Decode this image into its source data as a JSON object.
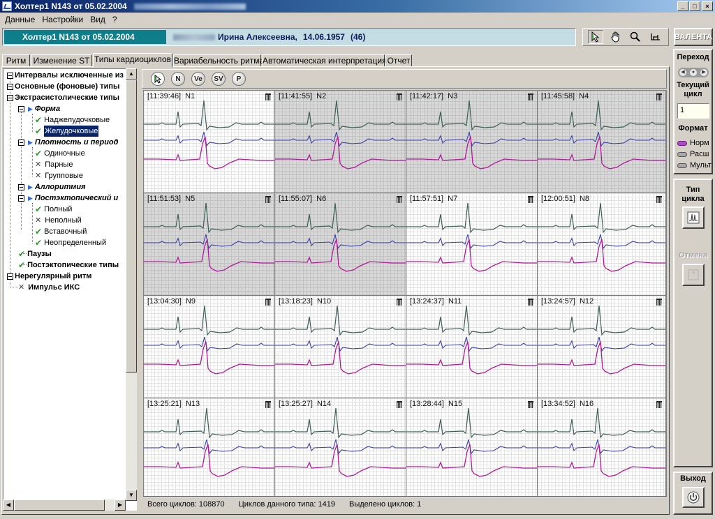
{
  "window": {
    "title": "Холтер1  N143 от 05.02.2004",
    "controls": [
      "_",
      "□",
      "×"
    ]
  },
  "menu": [
    "Данные",
    "Настройки",
    "Вид",
    "?"
  ],
  "record_bar": {
    "record": "Холтер1  N143 от 05.02.2004",
    "patient_name": "Ирина Алексеевна,",
    "birth_date": "14.06.1957",
    "age": "(46)"
  },
  "tools": {
    "pointer": "pointer-icon",
    "hand": "hand-icon",
    "zoom": "magnifier-icon",
    "measure": "caliper-icon"
  },
  "brand": "ВАЛЕНТА",
  "tabs": [
    "Ритм",
    "Изменение ST",
    "Типы кардиоциклов",
    "Вариабельность ритма",
    "Автоматическая интерпретация",
    "Отчет"
  ],
  "active_tab": "Типы кардиоциклов",
  "tree": [
    "Интервалы исключенные из",
    "Основные (фоновые) типы",
    "Экстрасистолические типы",
    "Форма",
    "Наджелудочковые",
    "Желудочковые",
    "Плотность и период",
    "Одиночные",
    "Парные",
    "Групповые",
    "Аллоритмия",
    "Постэктопический и",
    "Полный",
    "Неполный",
    "Вставочный",
    "Неопределенный",
    "Паузы",
    "Постэктопические типы",
    "Нерегулярный ритм",
    "Импульс ИКС"
  ],
  "cycle_toolbar": [
    "N",
    "Ve",
    "SV",
    "P"
  ],
  "cycles": [
    {
      "time": "[11:39:46]",
      "id": "N1"
    },
    {
      "time": "[11:41:55]",
      "id": "N2"
    },
    {
      "time": "[11:42:17]",
      "id": "N3"
    },
    {
      "time": "[11:45:58]",
      "id": "N4"
    },
    {
      "time": "[11:51:53]",
      "id": "N5"
    },
    {
      "time": "[11:55:07]",
      "id": "N6"
    },
    {
      "time": "[11:57:51]",
      "id": "N7"
    },
    {
      "time": "[12:00:51]",
      "id": "N8"
    },
    {
      "time": "[13:04:30]",
      "id": "N9"
    },
    {
      "time": "[13:18:23]",
      "id": "N10"
    },
    {
      "time": "[13:24:37]",
      "id": "N11"
    },
    {
      "time": "[13:24:57]",
      "id": "N12"
    },
    {
      "time": "[13:25:21]",
      "id": "N13"
    },
    {
      "time": "[13:25:27]",
      "id": "N14"
    },
    {
      "time": "[13:28:44]",
      "id": "N15"
    },
    {
      "time": "[13:34:52]",
      "id": "N16"
    }
  ],
  "status": {
    "total": "Всего циклов: 108870",
    "this_type": "Циклов данного типа: 1419",
    "selected": "Выделено циклов: 1"
  },
  "right_panel": {
    "navigate": "Переход",
    "current_cycle_label1": "Текущий",
    "current_cycle_label2": "цикл",
    "current_cycle_value": "1",
    "format_label": "Формат",
    "formats": [
      "Норм",
      "Расш",
      "Мульт"
    ],
    "cycle_type_label1": "Тип",
    "cycle_type_label2": "цикла",
    "undo": "Отмена",
    "exit": "Выход"
  },
  "colors": {
    "lead1": "#3f5f5a",
    "lead2": "#3a3fa8",
    "lead3": "#b01a9a",
    "record_bg": "#0e7e8a",
    "selection": "#0a246a"
  }
}
